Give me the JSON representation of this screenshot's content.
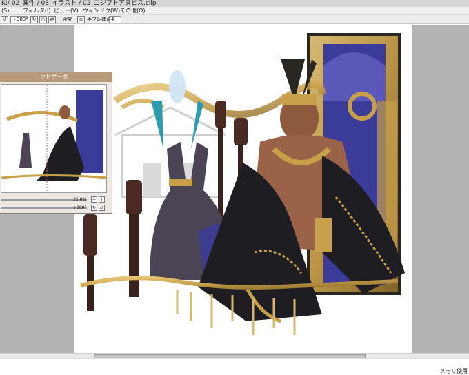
{
  "window": {
    "title": "K:/ 02_案件 / 08_イラスト / 02_エジプトアヌビス.clip"
  },
  "menubar": {
    "items": [
      "(S)",
      "フィルタ(I)",
      "ビュー(V)",
      "ウィンドウ(W)",
      "その他(O)"
    ]
  },
  "toolbar": {
    "rotation_value": "+000°",
    "blend_mode": "通常",
    "stabilization_label": "手ブレ補正",
    "stabilization_value": "4"
  },
  "navigator": {
    "title": "ナビゲータ",
    "zoom_value": "25.0%",
    "rotation_value": "+000°"
  },
  "status": {
    "memory_label": "メモリ使用"
  },
  "colors": {
    "workspace_bg": "#b3b3b3",
    "canvas_bg": "#ffffff",
    "panel_title_bg": "#b89a79",
    "gold": "#c9a04a",
    "purple": "#3b3b9a",
    "black_cloth": "#1e1d22"
  }
}
